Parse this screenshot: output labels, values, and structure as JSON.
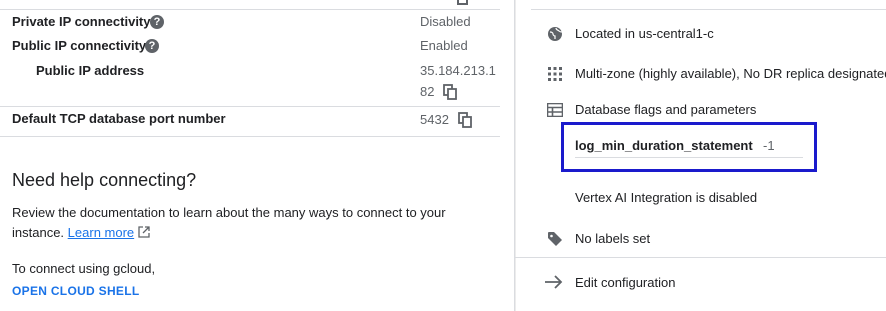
{
  "left": {
    "rows": [
      {
        "label": "Private IP connectivity",
        "value": "Disabled"
      },
      {
        "label": "Public IP connectivity",
        "value": "Enabled"
      },
      {
        "label": "Public IP address",
        "value_line1": "35.184.213.1",
        "value_line2": "82"
      },
      {
        "label": "Default TCP database port number",
        "value": "5432"
      }
    ],
    "help_heading": "Need help connecting?",
    "help_text": "Review the documentation to learn about the many ways to connect to your instance.",
    "help_text_line1": "Review the documentation to learn about the many ways to connect to your",
    "help_text_line2": "instance.",
    "learn_more": "Learn more",
    "gcloud_text": "To connect using gcloud,",
    "open_shell": "OPEN CLOUD SHELL"
  },
  "right": {
    "location": "Located in us-central1-c",
    "availability": "Multi-zone (highly available), No DR replica designated",
    "flags_heading": "Database flags and parameters",
    "flag": {
      "name": "log_min_duration_statement",
      "value": "-1"
    },
    "vertex": "Vertex AI Integration is disabled",
    "labels": "No labels set",
    "edit": "Edit configuration"
  },
  "colors": {
    "accent": "#1a73e8",
    "highlight_box": "#1a1acc",
    "muted": "#5f6368"
  },
  "icons": [
    "help-icon",
    "copy-icon",
    "external-link-icon",
    "globe-icon",
    "grid-icon",
    "table-icon",
    "tag-icon",
    "arrow-right-icon"
  ]
}
